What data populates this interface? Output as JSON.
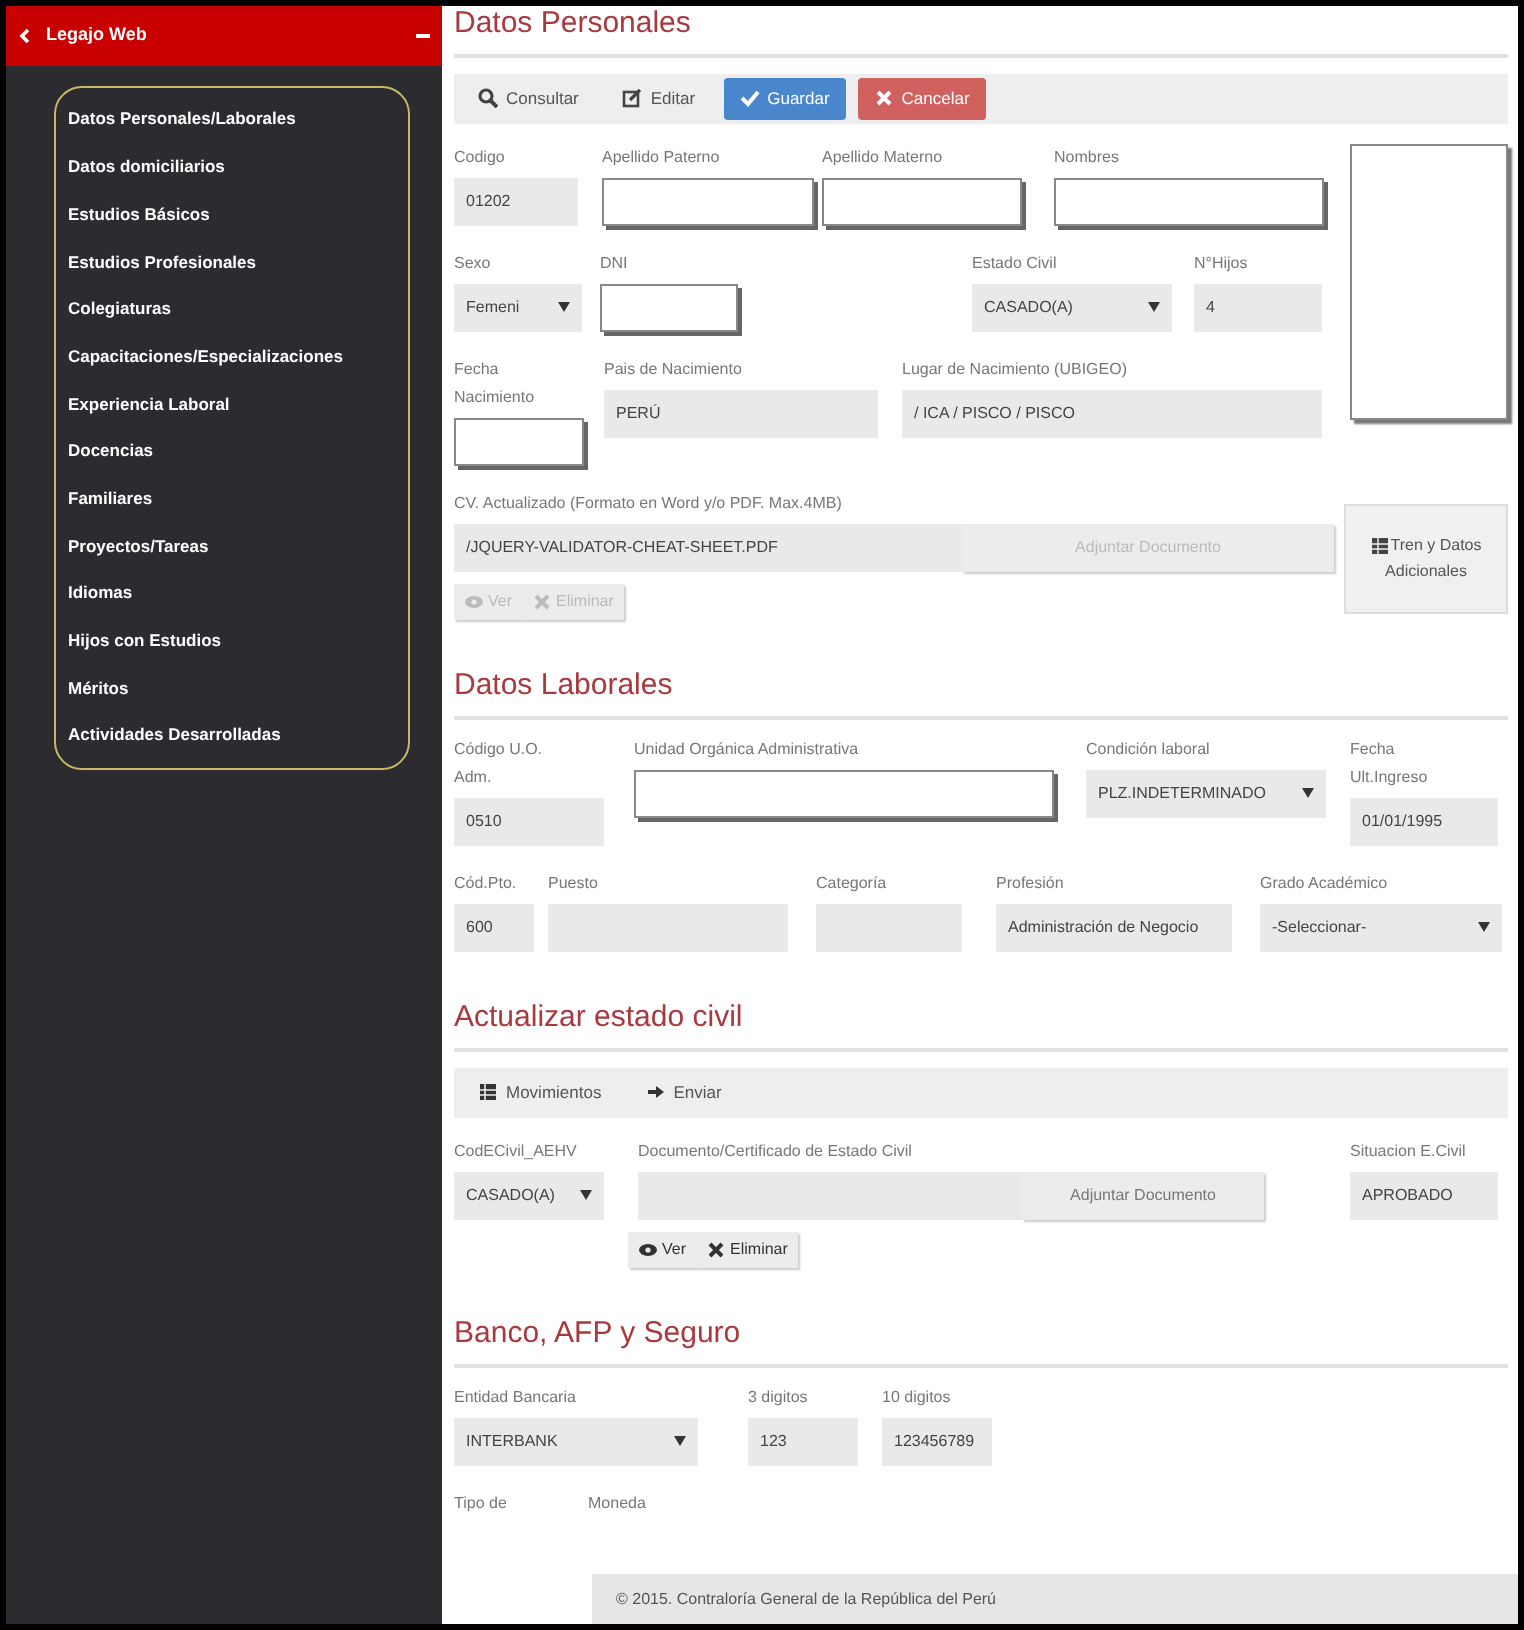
{
  "sidebar": {
    "title": "Legajo Web",
    "items": [
      {
        "label": "Datos Personales/Laborales"
      },
      {
        "label": "Datos domiciliarios"
      },
      {
        "label": "Estudios Básicos"
      },
      {
        "label": "Estudios Profesionales"
      },
      {
        "label": "Colegiaturas"
      },
      {
        "label": "Capacitaciones/Especializaciones"
      },
      {
        "label": "Experiencia Laboral"
      },
      {
        "label": "Docencias"
      },
      {
        "label": "Familiares"
      },
      {
        "label": "Proyectos/Tareas"
      },
      {
        "label": "Idiomas"
      },
      {
        "label": "Hijos con Estudios"
      },
      {
        "label": "Méritos"
      },
      {
        "label": "Actividades Desarrolladas"
      }
    ]
  },
  "sections": [
    {
      "title": "Datos Personales",
      "toolbar": [
        {
          "label": "Consultar",
          "kind": "search"
        },
        {
          "label": "Editar",
          "kind": "edit"
        },
        {
          "label": "Guardar",
          "kind": "save"
        },
        {
          "label": "Cancelar",
          "kind": "cancel"
        }
      ],
      "photo_box": true,
      "side_button": {
        "label": "Tren y Datos Adicionales",
        "kind": "table"
      },
      "lines": [
        {
          "fields": [
            {
              "label": "Codigo",
              "kind": "text",
              "value": "01202",
              "editable": false
            },
            {
              "label": "Apellido Paterno",
              "kind": "text",
              "editable": true
            },
            {
              "label": "Apellido Materno",
              "kind": "text",
              "editable": true
            },
            {
              "label": "Nombres",
              "kind": "text",
              "editable": true
            }
          ]
        },
        {
          "fields": [
            {
              "label": "Sexo",
              "kind": "select",
              "value": "Femeni"
            },
            {
              "label": "DNI",
              "kind": "text",
              "editable": true
            },
            {
              "label": "Estado Civil",
              "kind": "select",
              "value": "CASADO(A)"
            },
            {
              "label": "N°Hijos",
              "kind": "text",
              "value": "4",
              "editable": false
            }
          ]
        },
        {
          "fields": [
            {
              "label": "Fecha Nacimiento",
              "kind": "text",
              "editable": true
            },
            {
              "label": "Pais de Nacimiento",
              "kind": "text",
              "value": "PERÚ",
              "editable": false
            },
            {
              "label": "Lugar de Nacimiento (UBIGEO)",
              "kind": "text",
              "value": " / ICA / PISCO / PISCO",
              "editable": false
            }
          ]
        },
        {
          "fields": [
            {
              "label": "CV. Actualizado (Formato en Word y/o PDF. Max.4MB)",
              "kind": "file",
              "value": "/JQUERY-VALIDATOR-CHEAT-SHEET.PDF",
              "button": {
                "label": "Adjuntar Documento",
                "disabled": true
              },
              "actions": [
                {
                  "label": "Ver",
                  "kind": "view",
                  "disabled": true
                },
                {
                  "label": "Eliminar",
                  "kind": "delete",
                  "disabled": true
                }
              ]
            }
          ]
        }
      ]
    },
    {
      "title": "Datos Laborales",
      "lines": [
        {
          "fields": [
            {
              "label": "Código U.O. Adm.",
              "kind": "text",
              "value": "0510",
              "editable": false
            },
            {
              "label": "Unidad Orgánica Administrativa",
              "kind": "text",
              "editable": true
            },
            {
              "label": "Condición laboral",
              "kind": "select",
              "value": "PLZ.INDETERMINADO"
            },
            {
              "label": "Fecha Ult.Ingreso",
              "kind": "text",
              "value": "01/01/1995",
              "editable": false
            }
          ]
        },
        {
          "fields": [
            {
              "label": "Cód.Pto.",
              "kind": "text",
              "value": "600",
              "editable": false
            },
            {
              "label": "Puesto",
              "kind": "text",
              "editable": false
            },
            {
              "label": "Categoría",
              "kind": "text",
              "editable": false
            },
            {
              "label": "Profesión",
              "kind": "text",
              "value": "Administración de Negocio",
              "editable": false
            },
            {
              "label": "Grado Académico",
              "kind": "select",
              "value": "-Seleccionar-"
            }
          ]
        }
      ]
    },
    {
      "title": "Actualizar estado civil",
      "toolbar": [
        {
          "label": "Movimientos",
          "kind": "list"
        },
        {
          "label": "Enviar",
          "kind": "send"
        }
      ],
      "lines": [
        {
          "fields": [
            {
              "label": "CodECivil_AEHV",
              "kind": "select",
              "value": "CASADO(A)"
            },
            {
              "label": "Documento/Certificado de Estado Civil",
              "kind": "file",
              "button": {
                "label": "Adjuntar Documento",
                "disabled": false
              },
              "actions": [
                {
                  "label": "Ver",
                  "kind": "view",
                  "disabled": false
                },
                {
                  "label": "Eliminar",
                  "kind": "delete",
                  "disabled": false
                }
              ]
            },
            {
              "label": "Situacion E.Civil",
              "kind": "text",
              "value": "APROBADO",
              "editable": false
            }
          ]
        }
      ]
    },
    {
      "title": "Banco, AFP y Seguro",
      "lines": [
        {
          "fields": [
            {
              "label": "Entidad Bancaria",
              "kind": "select",
              "value": "INTERBANK"
            },
            {
              "label": "3 digitos",
              "kind": "text",
              "value": "123",
              "editable": false
            },
            {
              "label": "10 digitos",
              "kind": "text",
              "value": "123456789",
              "editable": false
            }
          ]
        },
        {
          "fields": [
            {
              "label": "Tipo de",
              "kind": "label"
            },
            {
              "label": "Moneda",
              "kind": "label"
            }
          ]
        }
      ]
    }
  ],
  "footer": "© 2015. Contraloría General de la República del Perú"
}
